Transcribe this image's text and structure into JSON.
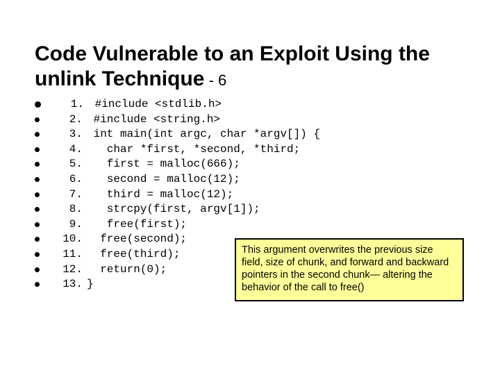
{
  "title_main": "Code Vulnerable to an Exploit Using the unlink Technique",
  "title_suffix": " - 6",
  "code": {
    "l1": {
      "n": " 1.",
      "t": " #include <stdlib.h>"
    },
    "l2": {
      "n": " 2.",
      "t": " #include <string.h>"
    },
    "l3": {
      "n": " 3.",
      "t": " int main(int argc, char *argv[]) {"
    },
    "l4": {
      "n": " 4.",
      "t": "   char *first, *second, *third;"
    },
    "l5": {
      "n": " 5.",
      "t": "   first = malloc(666);"
    },
    "l6": {
      "n": " 6.",
      "t": "   second = malloc(12);"
    },
    "l7": {
      "n": " 7.",
      "t": "   third = malloc(12);"
    },
    "l8": {
      "n": " 8.",
      "t": "   strcpy(first, argv[1]);"
    },
    "l9": {
      "n": " 9.",
      "t": "   free(first);"
    },
    "l10": {
      "n": "10.",
      "t": "  free(second);"
    },
    "l11": {
      "n": "11.",
      "t": "  free(third);"
    },
    "l12": {
      "n": "12.",
      "t": "  return(0);"
    },
    "l13": {
      "n": "13.",
      "t": "}"
    }
  },
  "callout": "This argument overwrites the previous size field, size of chunk, and forward and backward pointers in the second chunk— altering the behavior of the call to free()"
}
